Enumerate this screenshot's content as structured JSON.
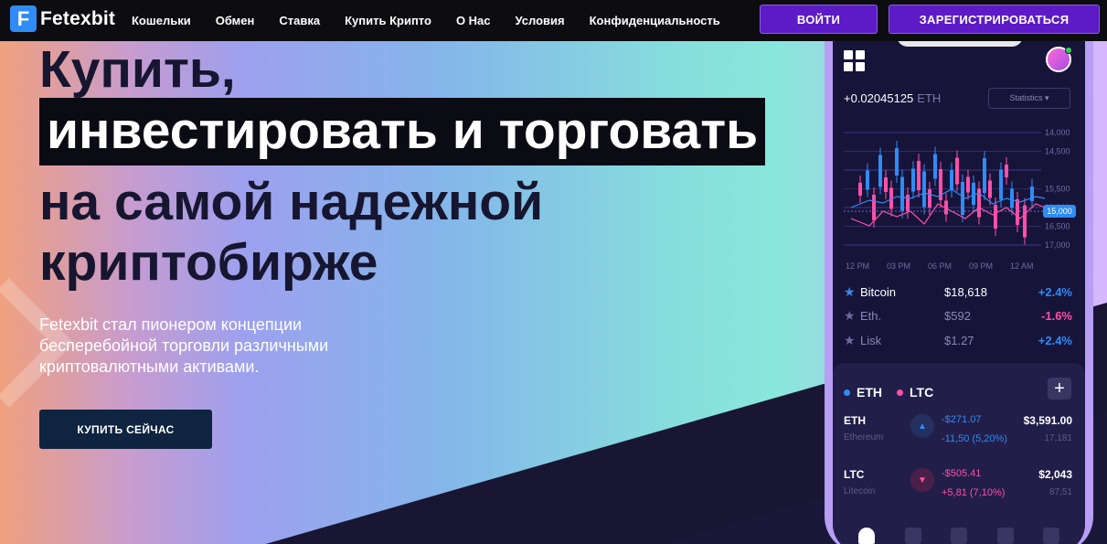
{
  "nav": {
    "logo_letter": "F",
    "logo_text": "Fetexbit",
    "links": [
      "Кошельки",
      "Обмен",
      "Ставка",
      "Купить Крипто",
      "О Нас",
      "Условия",
      "Конфиденциальность"
    ],
    "login": "ВОЙТИ",
    "register": "ЗАРЕГИСТРИРОВАТЬСЯ"
  },
  "hero": {
    "line1": "Купить,",
    "line2": "инвестировать и торговать",
    "line3": "на самой надежной",
    "line4": "криптобирже",
    "subtitle": "Fetexbit стал пионером концепции бесперебойной торговли различными криптовалютными активами.",
    "cta": "КУПИТЬ СЕЙЧАС"
  },
  "phone": {
    "balance": "+0.02045125",
    "balance_unit": "ETH",
    "stats_button": "Statistics ▾",
    "y_ticks": [
      "14,000",
      "14,500",
      "15,000",
      "15,500",
      "16,000",
      "16,500",
      "17,000"
    ],
    "current_price": "15,000",
    "x_ticks": [
      "12 PM",
      "03 PM",
      "06 PM",
      "09 PM",
      "12 AM"
    ],
    "coins": [
      {
        "name": "Bitcoin",
        "price": "$18,618",
        "change": "+2.4%"
      },
      {
        "name": "Eth.",
        "price": "$592",
        "change": "-1.6%"
      },
      {
        "name": "Lisk",
        "price": "$1.27",
        "change": "+2.4%"
      }
    ],
    "tabs": [
      "ETH",
      "LTC"
    ],
    "plus": "+",
    "assets": [
      {
        "symbol": "ETH",
        "full": "Ethereum",
        "change_abs": "-$271.07",
        "change_pct": "-11,50 (5,20%)",
        "value": "$3,591.00",
        "volume": "17,181"
      },
      {
        "symbol": "LTC",
        "full": "Litecoin",
        "change_abs": "-$505.41",
        "change_pct": "+5,81 (7,10%)",
        "value": "$2,043",
        "volume": "87,51"
      }
    ],
    "colors": {
      "up": "#2f8cf5",
      "down": "#ff4fa8",
      "accent": "#5c1bc6"
    }
  }
}
